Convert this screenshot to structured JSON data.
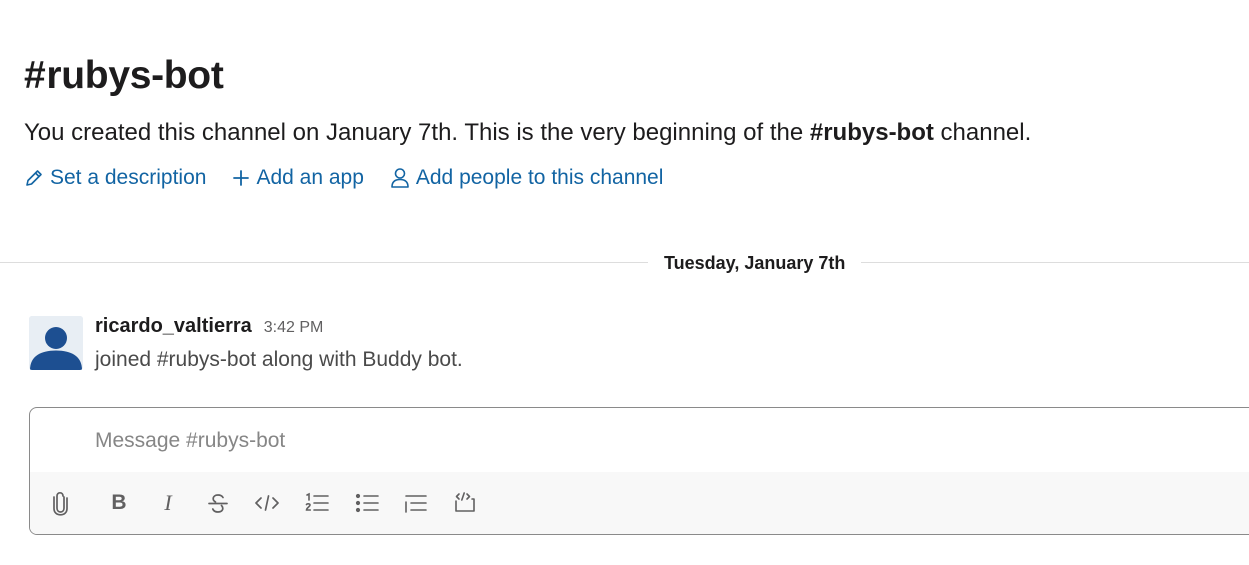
{
  "channel": {
    "hash": "#",
    "name": "rubys-bot"
  },
  "intro": {
    "before": "You created this channel on January 7th. This is the very beginning of the ",
    "channel_ref": "#rubys-bot",
    "after": " channel."
  },
  "actions": [
    {
      "label": "Set a description",
      "icon": "pencil-icon"
    },
    {
      "label": "Add an app",
      "icon": "plus-icon"
    },
    {
      "label": "Add people to this channel",
      "icon": "person-icon"
    }
  ],
  "date_divider": "Tuesday, January 7th",
  "message": {
    "author": "ricardo_valtierra",
    "time": "3:42 PM",
    "text": "joined #rubys-bot along with Buddy bot.",
    "avatar_icon": "default-user-avatar"
  },
  "composer": {
    "placeholder": "Message #rubys-bot",
    "value": "",
    "toolbar": [
      {
        "name": "attach",
        "icon": "paperclip-icon"
      },
      {
        "name": "bold",
        "glyph": "B"
      },
      {
        "name": "italic",
        "glyph": "I"
      },
      {
        "name": "strikethrough",
        "icon": "strikethrough-icon"
      },
      {
        "name": "code",
        "icon": "code-icon"
      },
      {
        "name": "ordered-list",
        "icon": "ordered-list-icon"
      },
      {
        "name": "bulleted-list",
        "icon": "bulleted-list-icon"
      },
      {
        "name": "blockquote",
        "icon": "blockquote-icon"
      },
      {
        "name": "code-block",
        "icon": "code-block-icon"
      }
    ]
  },
  "colors": {
    "link": "#1264a3",
    "avatar_figure": "#1d4f91",
    "avatar_bg": "#e8eef4",
    "toolbar_bg": "#f8f8f8"
  }
}
